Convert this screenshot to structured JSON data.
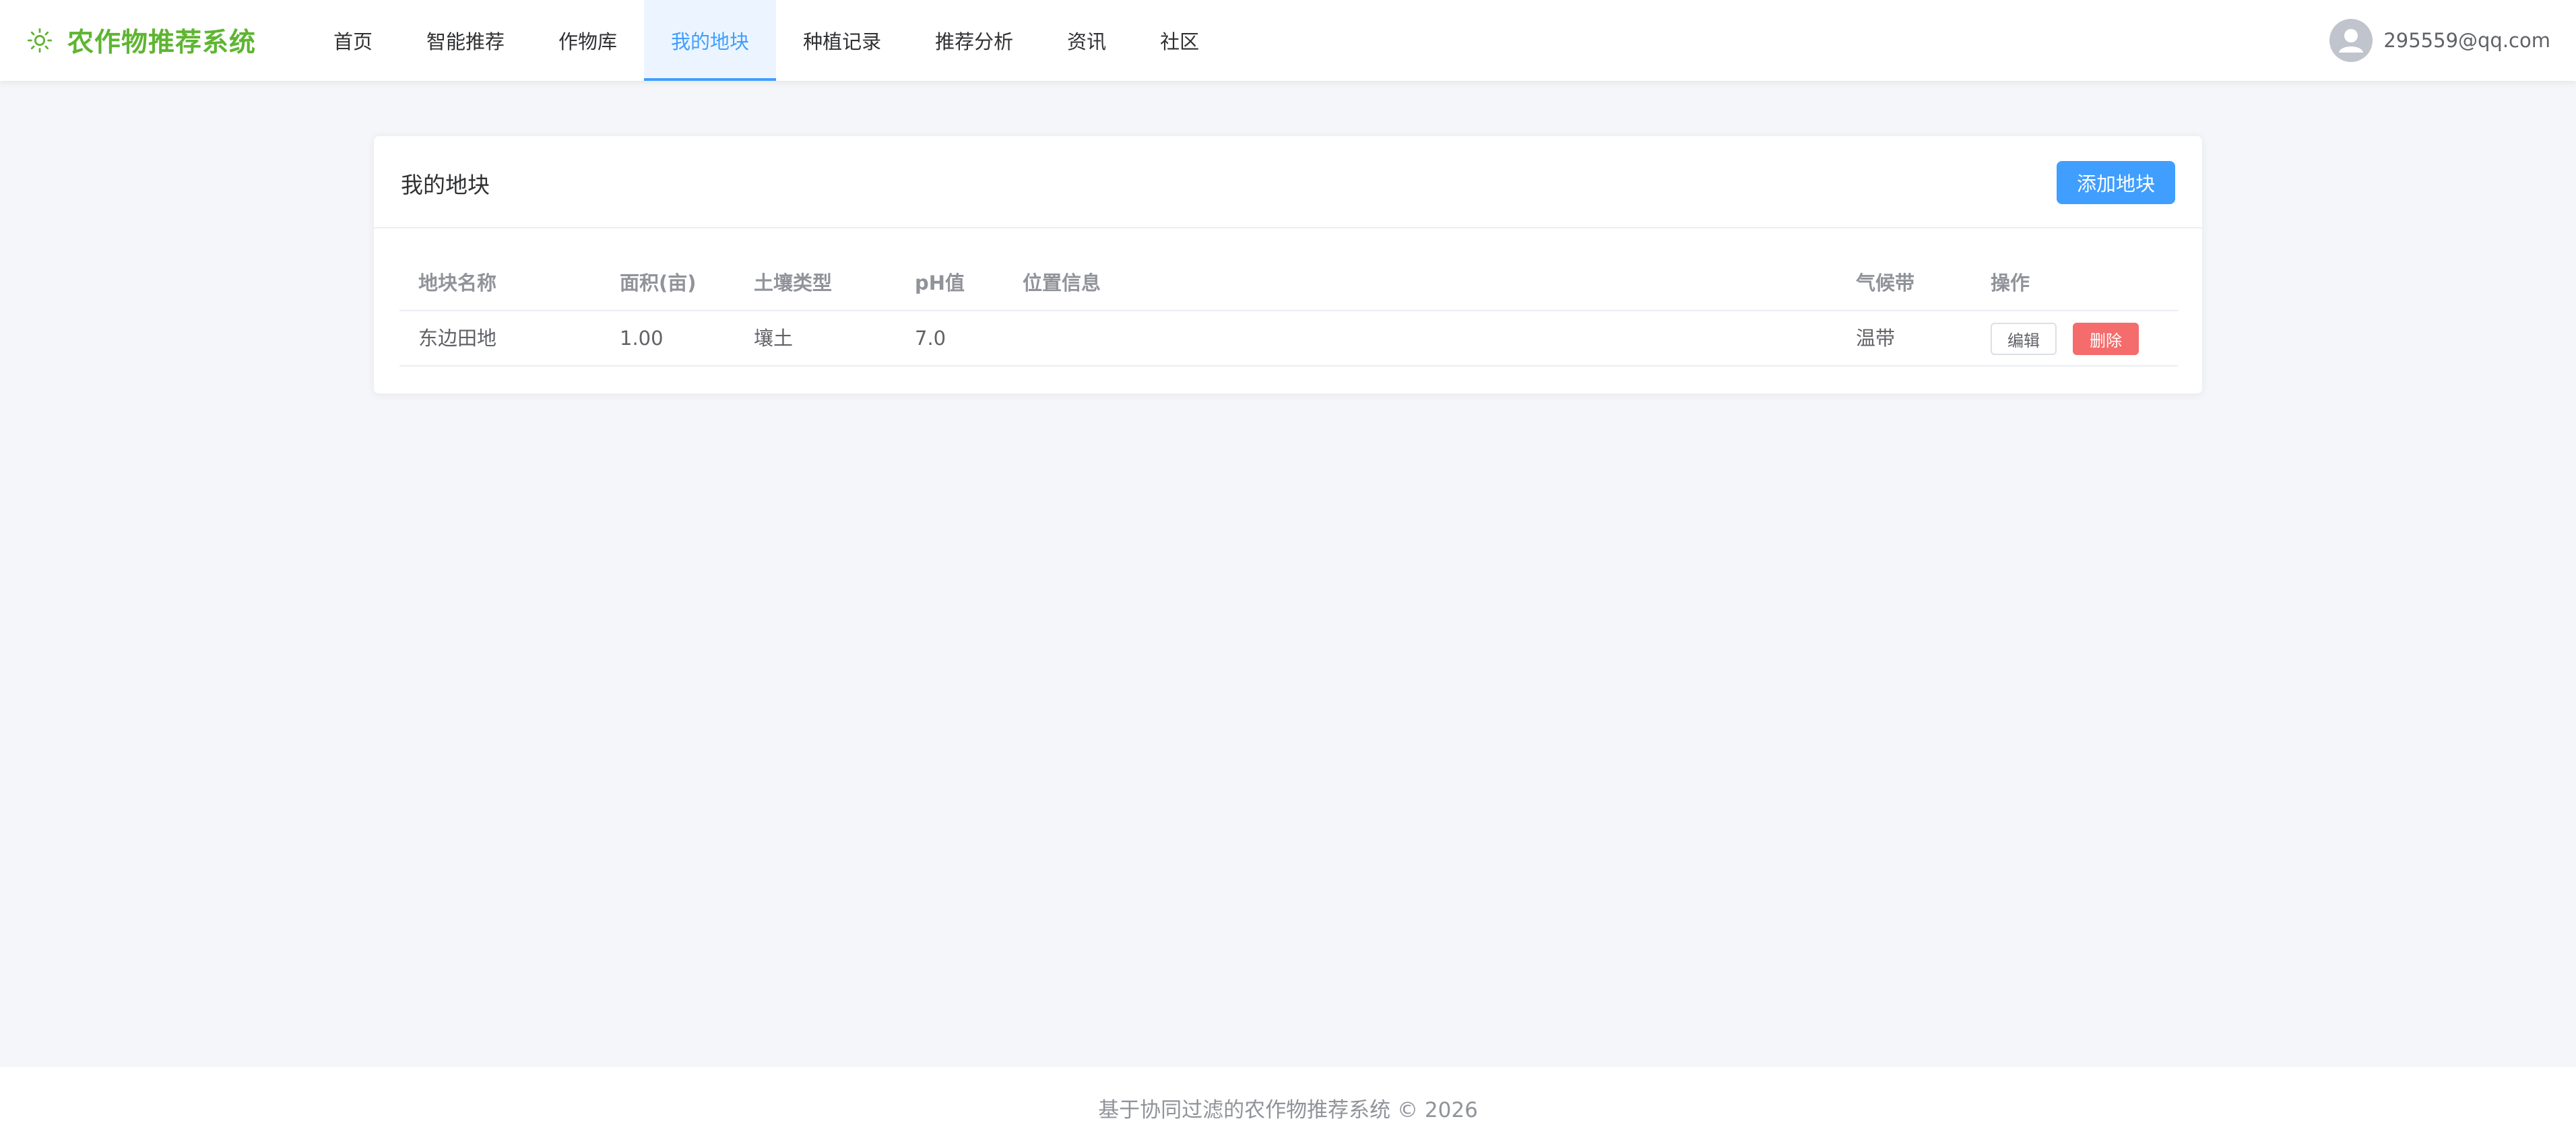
{
  "brand": {
    "title": "农作物推荐系统",
    "icon": "sun-icon",
    "color": "#5fb532"
  },
  "nav": {
    "items": [
      {
        "label": "首页"
      },
      {
        "label": "智能推荐"
      },
      {
        "label": "作物库"
      },
      {
        "label": "我的地块",
        "active": true
      },
      {
        "label": "种植记录"
      },
      {
        "label": "推荐分析"
      },
      {
        "label": "资讯"
      },
      {
        "label": "社区"
      }
    ],
    "active_color": "#409eff"
  },
  "user": {
    "email": "295559@qq.com",
    "avatar_icon": "user-avatar-icon"
  },
  "card": {
    "title": "我的地块",
    "add_button": "添加地块"
  },
  "table": {
    "columns": [
      "地块名称",
      "面积(亩)",
      "土壤类型",
      "pH值",
      "位置信息",
      "气候带",
      "操作"
    ],
    "rows": [
      {
        "name": "东边田地",
        "area": "1.00",
        "soil": "壤土",
        "ph": "7.0",
        "location": "",
        "climate": "温带",
        "edit_label": "编辑",
        "delete_label": "删除"
      }
    ]
  },
  "colors": {
    "primary": "#409eff",
    "danger": "#f56c6c",
    "background": "#f5f6f9"
  },
  "footer": {
    "text": "基于协同过滤的农作物推荐系统 © 2026"
  }
}
